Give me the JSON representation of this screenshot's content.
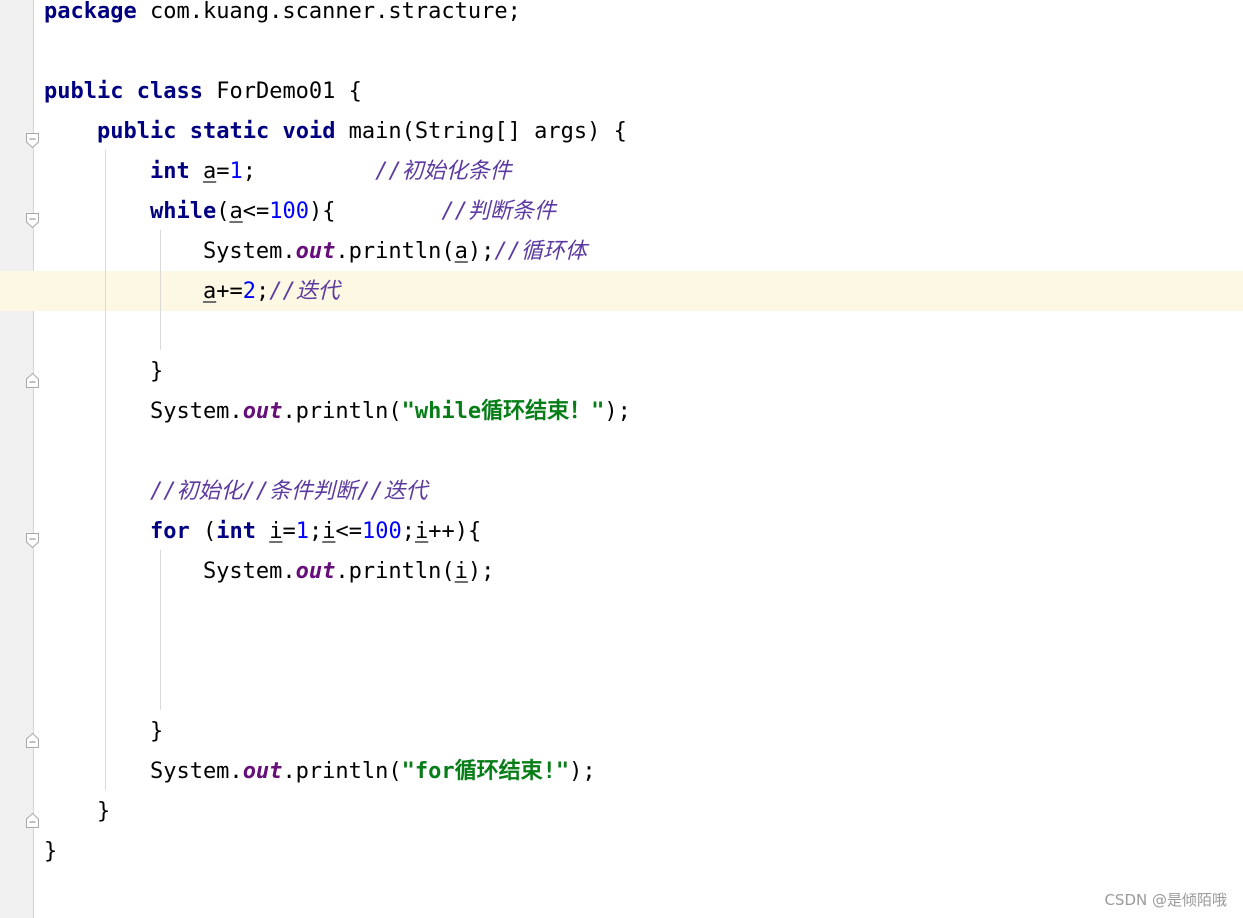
{
  "code_lines": [
    {
      "segments": [
        {
          "text": "package",
          "style": "kw"
        },
        {
          "text": " com.kuang.scanner.stracture;",
          "style": "plain"
        }
      ]
    },
    {
      "segments": []
    },
    {
      "segments": [
        {
          "text": "public",
          "style": "kw"
        },
        {
          "text": " ",
          "style": "plain"
        },
        {
          "text": "class",
          "style": "kw"
        },
        {
          "text": " ForDemo01 {",
          "style": "plain"
        }
      ]
    },
    {
      "segments": [
        {
          "text": "    ",
          "style": "plain"
        },
        {
          "text": "public",
          "style": "kw"
        },
        {
          "text": " ",
          "style": "plain"
        },
        {
          "text": "static",
          "style": "kw"
        },
        {
          "text": " ",
          "style": "plain"
        },
        {
          "text": "void",
          "style": "kw"
        },
        {
          "text": " main(String[] args) {",
          "style": "plain"
        }
      ]
    },
    {
      "segments": [
        {
          "text": "        ",
          "style": "plain"
        },
        {
          "text": "int",
          "style": "kw"
        },
        {
          "text": " ",
          "style": "plain"
        },
        {
          "text": "a",
          "style": "var"
        },
        {
          "text": "=",
          "style": "plain"
        },
        {
          "text": "1",
          "style": "num"
        },
        {
          "text": ";         ",
          "style": "plain"
        },
        {
          "text": "//初始化条件",
          "style": "comment"
        }
      ]
    },
    {
      "segments": [
        {
          "text": "        ",
          "style": "plain"
        },
        {
          "text": "while",
          "style": "kw"
        },
        {
          "text": "(",
          "style": "plain"
        },
        {
          "text": "a",
          "style": "var"
        },
        {
          "text": "<=",
          "style": "plain"
        },
        {
          "text": "100",
          "style": "num"
        },
        {
          "text": "){        ",
          "style": "plain"
        },
        {
          "text": "//判断条件",
          "style": "comment"
        }
      ]
    },
    {
      "segments": [
        {
          "text": "            System.",
          "style": "plain"
        },
        {
          "text": "out",
          "style": "field"
        },
        {
          "text": ".println(",
          "style": "plain"
        },
        {
          "text": "a",
          "style": "var"
        },
        {
          "text": ");",
          "style": "plain"
        },
        {
          "text": "//循环体",
          "style": "comment"
        }
      ]
    },
    {
      "segments": [
        {
          "text": "            ",
          "style": "plain"
        },
        {
          "text": "a",
          "style": "var"
        },
        {
          "text": "+=",
          "style": "plain"
        },
        {
          "text": "2",
          "style": "num"
        },
        {
          "text": ";",
          "style": "plain"
        },
        {
          "text": "//迭代",
          "style": "comment"
        }
      ]
    },
    {
      "segments": []
    },
    {
      "segments": [
        {
          "text": "        }",
          "style": "plain"
        }
      ]
    },
    {
      "segments": [
        {
          "text": "        System.",
          "style": "plain"
        },
        {
          "text": "out",
          "style": "field"
        },
        {
          "text": ".println(",
          "style": "plain"
        },
        {
          "text": "\"while循环结束！\"",
          "style": "str"
        },
        {
          "text": ");",
          "style": "plain"
        }
      ]
    },
    {
      "segments": []
    },
    {
      "segments": [
        {
          "text": "        ",
          "style": "plain"
        },
        {
          "text": "//初始化//条件判断//迭代",
          "style": "comment"
        }
      ]
    },
    {
      "segments": [
        {
          "text": "        ",
          "style": "plain"
        },
        {
          "text": "for",
          "style": "kw"
        },
        {
          "text": " (",
          "style": "plain"
        },
        {
          "text": "int",
          "style": "kw"
        },
        {
          "text": " ",
          "style": "plain"
        },
        {
          "text": "i",
          "style": "var"
        },
        {
          "text": "=",
          "style": "plain"
        },
        {
          "text": "1",
          "style": "num"
        },
        {
          "text": ";",
          "style": "plain"
        },
        {
          "text": "i",
          "style": "var"
        },
        {
          "text": "<=",
          "style": "plain"
        },
        {
          "text": "100",
          "style": "num"
        },
        {
          "text": ";",
          "style": "plain"
        },
        {
          "text": "i",
          "style": "var"
        },
        {
          "text": "++){",
          "style": "plain"
        }
      ]
    },
    {
      "segments": [
        {
          "text": "            System.",
          "style": "plain"
        },
        {
          "text": "out",
          "style": "field"
        },
        {
          "text": ".println(",
          "style": "plain"
        },
        {
          "text": "i",
          "style": "var"
        },
        {
          "text": ");",
          "style": "plain"
        }
      ]
    },
    {
      "segments": []
    },
    {
      "segments": []
    },
    {
      "segments": []
    },
    {
      "segments": [
        {
          "text": "        }",
          "style": "plain"
        }
      ]
    },
    {
      "segments": [
        {
          "text": "        System.",
          "style": "plain"
        },
        {
          "text": "out",
          "style": "field"
        },
        {
          "text": ".println(",
          "style": "plain"
        },
        {
          "text": "\"for循环结束!\"",
          "style": "str"
        },
        {
          "text": ");",
          "style": "plain"
        }
      ]
    },
    {
      "segments": [
        {
          "text": "    }",
          "style": "plain"
        }
      ]
    },
    {
      "segments": [
        {
          "text": "}",
          "style": "plain"
        }
      ]
    }
  ],
  "gutter": {
    "fold_markers": [
      {
        "line": 4,
        "type": "open-icon"
      },
      {
        "line": 6,
        "type": "open-icon"
      },
      {
        "line": 10,
        "type": "close-icon"
      },
      {
        "line": 14,
        "type": "open-icon"
      },
      {
        "line": 19,
        "type": "close-icon"
      },
      {
        "line": 21,
        "type": "close-icon"
      }
    ]
  },
  "current_line": 8,
  "colors": {
    "keyword": "#000080",
    "number": "#0000ff",
    "string": "#067d17",
    "static_field": "#660e7a",
    "comment": "#5c3aa0",
    "current_line_bg": "#fdf8e3",
    "gutter_bg": "#f0f0f0"
  },
  "watermark": "CSDN @是倾陌哦"
}
